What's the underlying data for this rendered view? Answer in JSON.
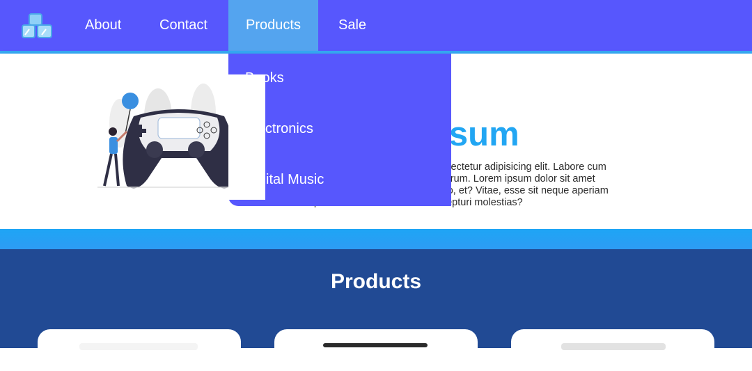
{
  "nav": {
    "links": [
      "About",
      "Contact",
      "Products",
      "Sale"
    ],
    "active": "Products"
  },
  "dropdown": {
    "items": [
      "Books",
      "Electronics",
      "Digital Music"
    ]
  },
  "hero": {
    "title": "Lorem Ipsum",
    "text": "Lorem ipsum dolor sit amet consectetur adipisicing elit. Labore cum facere commodi pariatur optio rerum. Lorem ipsum dolor sit amet consectetur adipisicing elit. Porro, et? Vitae, esse sit neque aperiam repellendus consectetur hic excepturi molestias?"
  },
  "products": {
    "title": "Products",
    "card_count": 3
  },
  "colors": {
    "nav": "#5757fd",
    "active_tab": "#54a4ef",
    "accent": "#22a6f3",
    "section": "#214a94"
  },
  "icons": [
    "ice-cubes-logo-icon",
    "controller-illustration"
  ]
}
